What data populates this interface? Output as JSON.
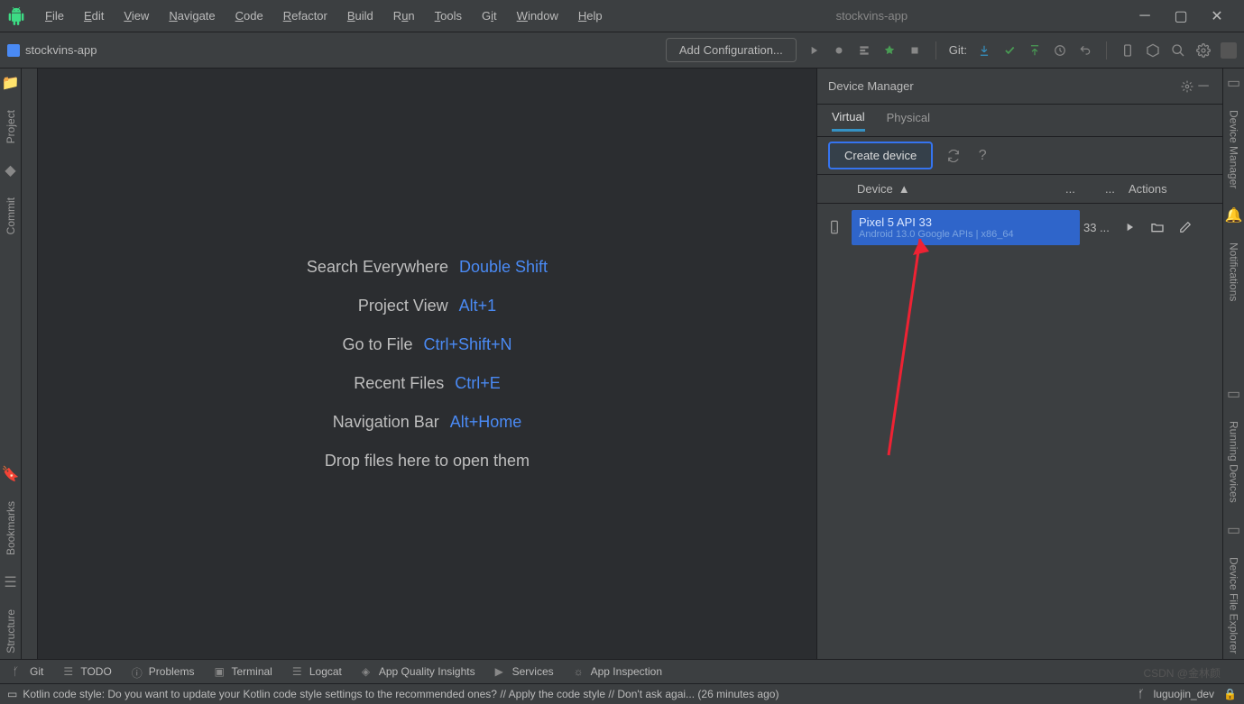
{
  "app_name": "stockvins-app",
  "menu": [
    "File",
    "Edit",
    "View",
    "Navigate",
    "Code",
    "Refactor",
    "Build",
    "Run",
    "Tools",
    "Git",
    "Window",
    "Help"
  ],
  "project_chip": "stockvins-app",
  "config_button": "Add Configuration...",
  "git_label": "Git:",
  "left_tools": [
    "Project",
    "Commit",
    "Bookmarks",
    "Structure"
  ],
  "hints": [
    {
      "label": "Search Everywhere",
      "key": "Double Shift"
    },
    {
      "label": "Project View",
      "key": "Alt+1"
    },
    {
      "label": "Go to File",
      "key": "Ctrl+Shift+N"
    },
    {
      "label": "Recent Files",
      "key": "Ctrl+E"
    },
    {
      "label": "Navigation Bar",
      "key": "Alt+Home"
    }
  ],
  "drop_hint": "Drop files here to open them",
  "device_manager": {
    "title": "Device Manager",
    "tabs": [
      "Virtual",
      "Physical"
    ],
    "create": "Create device",
    "columns": {
      "device": "Device",
      "api": "...",
      "actions": "Actions"
    },
    "device": {
      "name": "Pixel 5 API 33",
      "sub": "Android 13.0 Google APIs | x86_64",
      "api": "33 ..."
    }
  },
  "right_tools": [
    "Device Manager",
    "Notifications",
    "Running Devices",
    "Device File Explorer"
  ],
  "bottom_tools": [
    "Git",
    "TODO",
    "Problems",
    "Terminal",
    "Logcat",
    "App Quality Insights",
    "Services",
    "App Inspection"
  ],
  "status_msg": "Kotlin code style: Do you want to update your Kotlin code style settings to the recommended ones? // Apply the code style // Don't ask agai... (26 minutes ago)",
  "status_branch": "luguojin_dev",
  "watermark": "CSDN @金林颜"
}
